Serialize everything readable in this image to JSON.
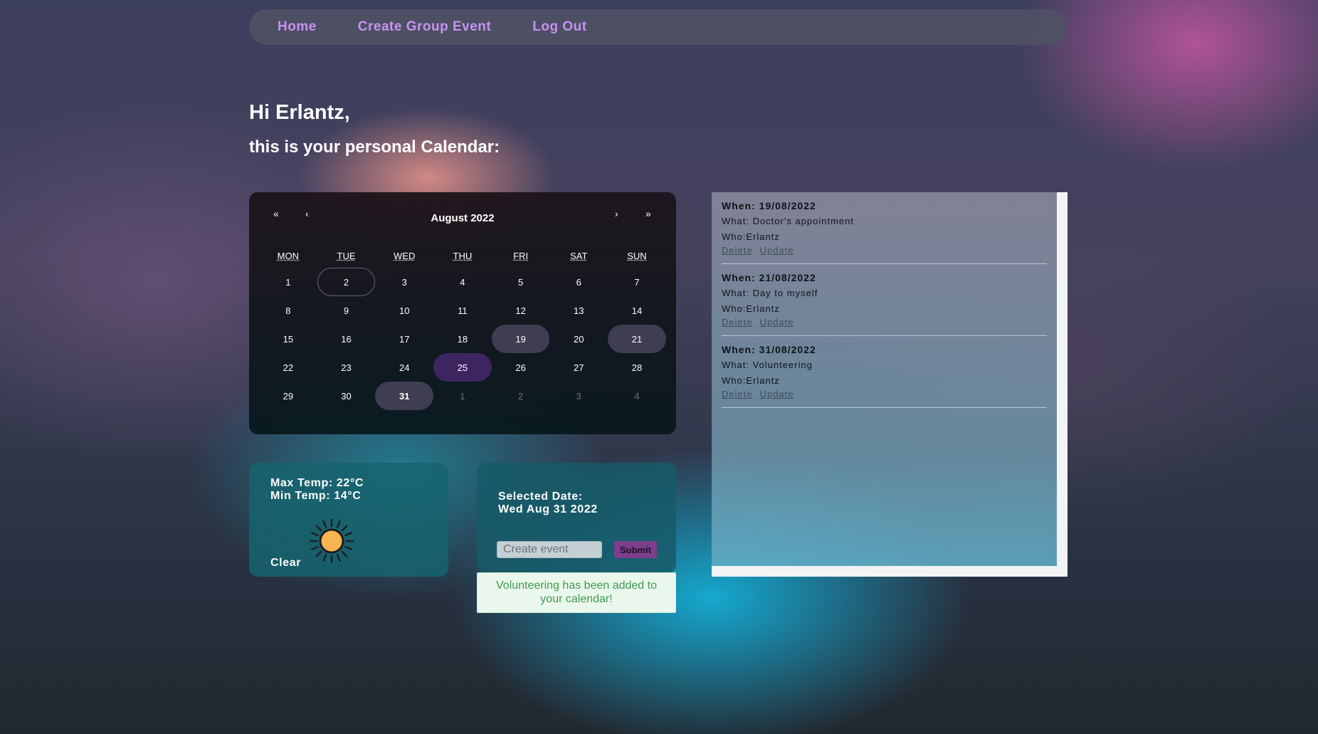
{
  "nav": {
    "home": "Home",
    "create_group_event": "Create Group Event",
    "log_out": "Log Out"
  },
  "header": {
    "greeting": "Hi Erlantz,",
    "subtitle": "this is your personal Calendar:"
  },
  "calendar": {
    "prev_year": "«",
    "prev_month": "‹",
    "next_month": "›",
    "next_year": "»",
    "month_label": "August 2022",
    "weekdays": [
      "MON",
      "TUE",
      "WED",
      "THU",
      "FRI",
      "SAT",
      "SUN"
    ],
    "days": [
      {
        "label": "1"
      },
      {
        "label": "2",
        "state": "today"
      },
      {
        "label": "3"
      },
      {
        "label": "4"
      },
      {
        "label": "5"
      },
      {
        "label": "6"
      },
      {
        "label": "7"
      },
      {
        "label": "8"
      },
      {
        "label": "9"
      },
      {
        "label": "10"
      },
      {
        "label": "11"
      },
      {
        "label": "12"
      },
      {
        "label": "13"
      },
      {
        "label": "14"
      },
      {
        "label": "15"
      },
      {
        "label": "16"
      },
      {
        "label": "17"
      },
      {
        "label": "18"
      },
      {
        "label": "19",
        "state": "has-event"
      },
      {
        "label": "20"
      },
      {
        "label": "21",
        "state": "has-event"
      },
      {
        "label": "22"
      },
      {
        "label": "23"
      },
      {
        "label": "24"
      },
      {
        "label": "25",
        "state": "highlight"
      },
      {
        "label": "26"
      },
      {
        "label": "27"
      },
      {
        "label": "28"
      },
      {
        "label": "29"
      },
      {
        "label": "30"
      },
      {
        "label": "31",
        "state": "selected"
      },
      {
        "label": "1",
        "state": "muted"
      },
      {
        "label": "2",
        "state": "muted"
      },
      {
        "label": "3",
        "state": "muted"
      },
      {
        "label": "4",
        "state": "muted"
      }
    ]
  },
  "weather": {
    "max_temp": "Max Temp: 22°C",
    "min_temp": "Min Temp: 14°C",
    "description": "Clear",
    "icon": "sun-icon",
    "sun_color": "#f6b552"
  },
  "event_form": {
    "selected_label": "Selected Date:",
    "selected_value": "Wed Aug 31 2022",
    "input_placeholder": "Create event",
    "submit_label": "Submit"
  },
  "message": {
    "text": "Volunteering has been added to your calendar!"
  },
  "events": [
    {
      "when": "When: 19/08/2022",
      "what": "What: Doctor's appointment",
      "who": "Who:Erlantz",
      "delete": "Delete",
      "update": "Update"
    },
    {
      "when": "When: 21/08/2022",
      "what": "What: Day to myself",
      "who": "Who:Erlantz",
      "delete": "Delete",
      "update": "Update"
    },
    {
      "when": "When: 31/08/2022",
      "what": "What: Volunteering",
      "who": "Who:Erlantz",
      "delete": "Delete",
      "update": "Update"
    }
  ]
}
